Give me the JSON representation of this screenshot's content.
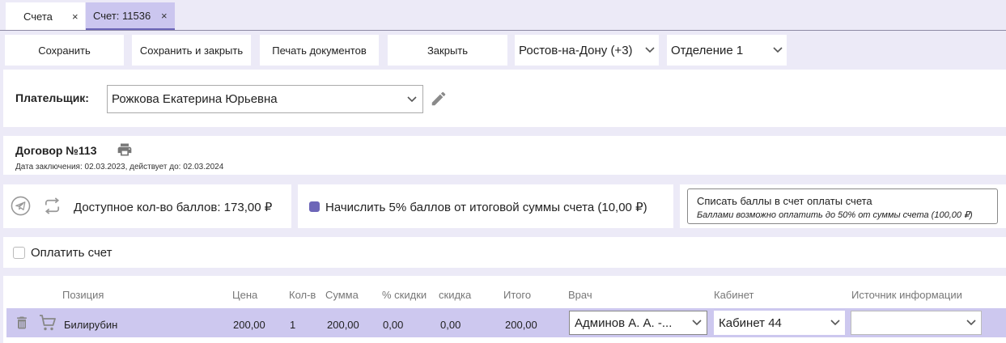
{
  "tabs": [
    {
      "label": "Счета",
      "close": "×"
    },
    {
      "label": "Счет: 11536",
      "close": "×"
    }
  ],
  "toolbar": {
    "save": "Сохранить",
    "save_close": "Сохранить и закрыть",
    "print_docs": "Печать документов",
    "close": "Закрыть",
    "city": "Ростов-на-Дону (+3)",
    "department": "Отделение 1"
  },
  "payer": {
    "label": "Плательщик:",
    "value": "Рожкова Екатерина Юрьевна"
  },
  "contract": {
    "title": "Договор №113",
    "subtitle": "Дата заключения: 02.03.2023, действует до: 02.03.2024"
  },
  "points": {
    "available": "Доступное кол-во баллов: 173,00 ₽",
    "accrue": "Начислить 5% баллов от итоговой суммы счета (10,00 ₽)",
    "accrue_checked": true,
    "writeoff_title": "Списать баллы в счет оплаты счета",
    "writeoff_note": "Баллами возможно оплатить до 50% от суммы счета (100,00 ₽)"
  },
  "pay": {
    "label": "Оплатить счет",
    "checked": false
  },
  "table": {
    "headers": {
      "position": "Позиция",
      "price": "Цена",
      "qty": "Кол-в",
      "sum": "Сумма",
      "discount_pct": "% скидки",
      "discount": "скидка",
      "total": "Итого",
      "doctor": "Врач",
      "room": "Кабинет",
      "source": "Источник информации"
    },
    "rows": [
      {
        "position": "Билирубин",
        "price": "200,00",
        "qty": "1",
        "sum": "200,00",
        "discount_pct": "0,00",
        "discount": "0,00",
        "total": "200,00",
        "doctor": "Админов А. А. -...",
        "room": "Кабинет 44",
        "source": ""
      }
    ]
  },
  "colors": {
    "accent": "#6d66b8",
    "selected_row": "#cdc8ef",
    "background": "#eceaf7"
  }
}
